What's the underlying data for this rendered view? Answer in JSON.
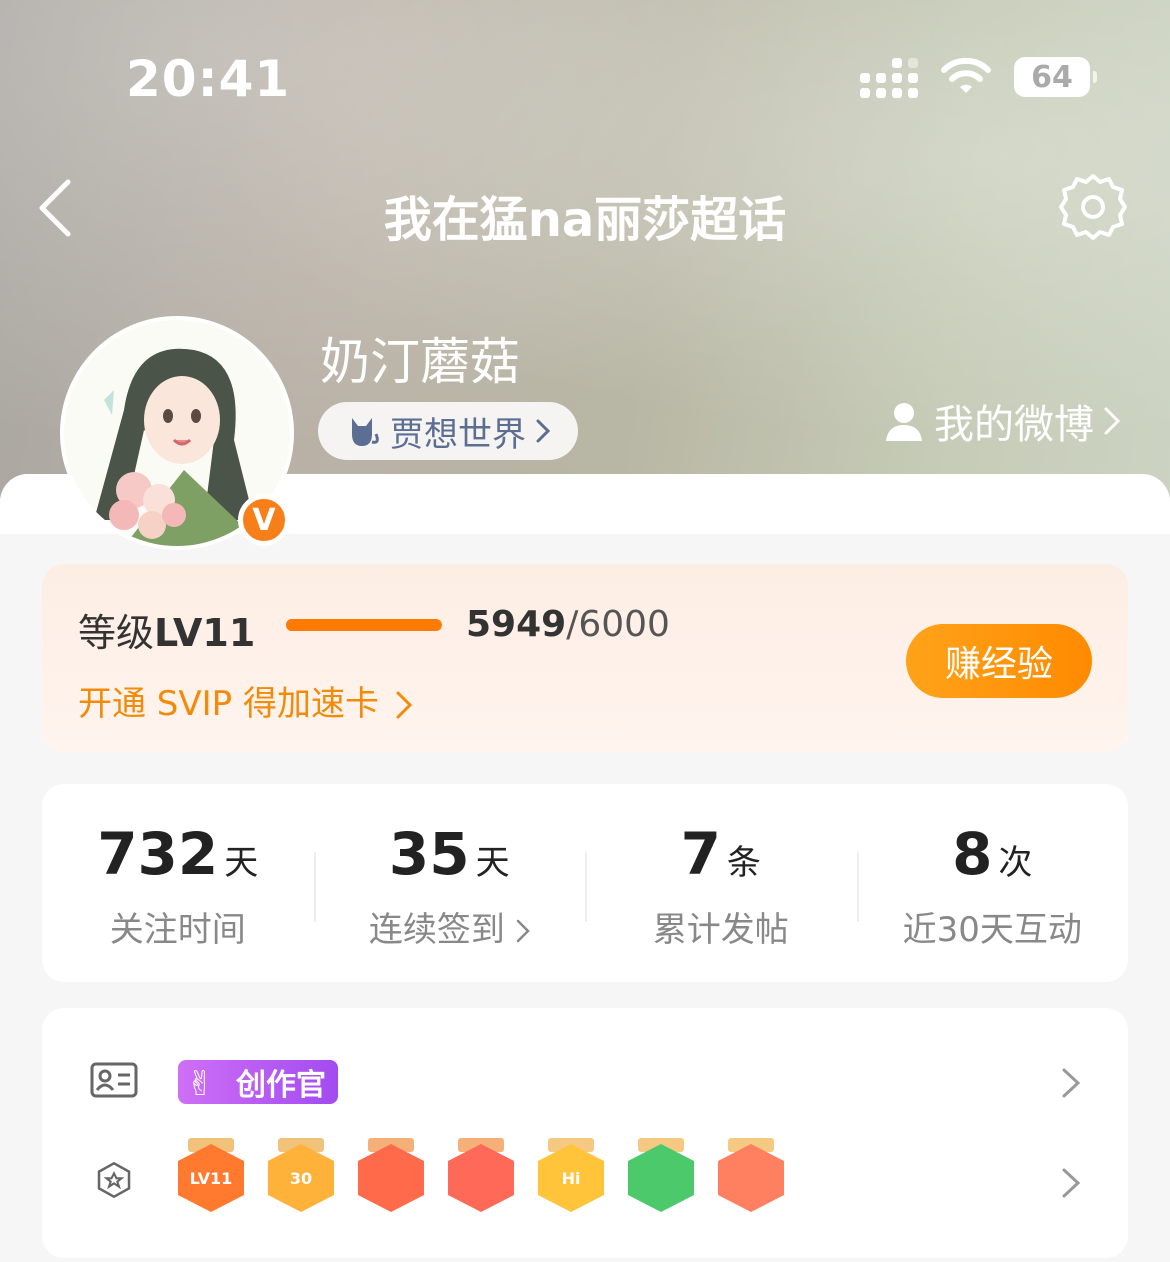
{
  "status_bar": {
    "time": "20:41",
    "battery": "64"
  },
  "nav": {
    "title": "我在猛na丽莎超话"
  },
  "profile": {
    "username": "奶汀蘑菇",
    "world_label": "贾想世界",
    "my_weibo_label": "我的微博",
    "verified_badge": "V"
  },
  "level": {
    "label_prefix": "等级",
    "level": "LV11",
    "current": "5949",
    "max": "/6000",
    "progress_fraction": 0.9915,
    "svip_link": "开通 SVIP 得加速卡",
    "earn_button": "赚经验"
  },
  "stats": [
    {
      "value": "732",
      "unit": "天",
      "label": "关注时间"
    },
    {
      "value": "35",
      "unit": "天",
      "label": "连续签到",
      "chevron": true
    },
    {
      "value": "7",
      "unit": "条",
      "label": "累计发帖"
    },
    {
      "value": "8",
      "unit": "次",
      "label": "近30天互动"
    }
  ],
  "badges": {
    "creator_tag": "创作官",
    "medals": [
      {
        "text": "LV11",
        "color": "#ff7a2e",
        "ribbon": "#f0c27a"
      },
      {
        "text": "30",
        "color": "#ffb23a",
        "ribbon": "#f0c27a"
      },
      {
        "text": "",
        "color": "#ff6a4a",
        "ribbon": "#f5b07a"
      },
      {
        "text": "",
        "color": "#ff6a58",
        "ribbon": "#f5b07a"
      },
      {
        "text": "Hi",
        "color": "#ffc43a",
        "ribbon": "#f5c982"
      },
      {
        "text": "",
        "color": "#4cc96a",
        "ribbon": "#f5c982"
      },
      {
        "text": "",
        "color": "#ff8060",
        "ribbon": "#f5c982"
      }
    ]
  },
  "colors": {
    "accent": "#ff8a00",
    "link": "#f28a0a"
  }
}
